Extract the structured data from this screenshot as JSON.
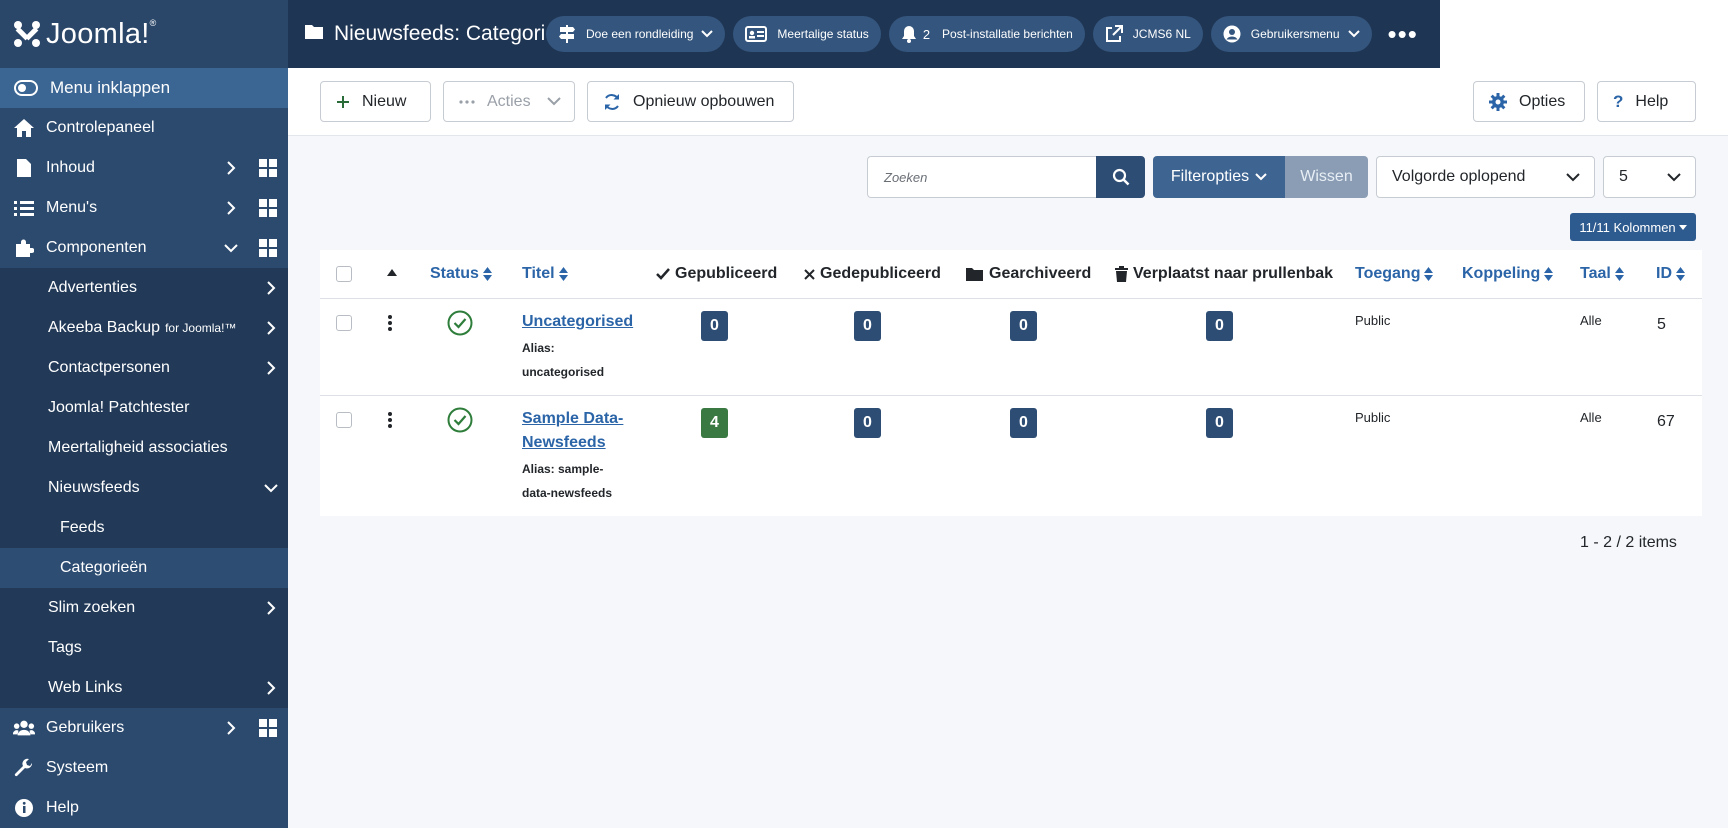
{
  "logo": {
    "text": "Joomla!",
    "mark": "®"
  },
  "sidebar": {
    "collapse_label": "Menu inklappen",
    "items": [
      {
        "label": "Controlepaneel",
        "icon": "home-icon"
      },
      {
        "label": "Inhoud",
        "icon": "file-icon"
      },
      {
        "label": "Menu's",
        "icon": "list-icon"
      },
      {
        "label": "Componenten",
        "icon": "puzzle-icon"
      },
      {
        "label": "Advertenties"
      },
      {
        "label": "Akeeba Backup",
        "suffix": "for Joomla!™"
      },
      {
        "label": "Contactpersonen"
      },
      {
        "label": "Joomla! Patchtester"
      },
      {
        "label": "Meertaligheid associaties"
      },
      {
        "label": "Nieuwsfeeds"
      },
      {
        "label": "Feeds"
      },
      {
        "label": "Categorieën"
      },
      {
        "label": "Slim zoeken"
      },
      {
        "label": "Tags"
      },
      {
        "label": "Web Links"
      },
      {
        "label": "Gebruikers",
        "icon": "users-icon"
      },
      {
        "label": "Systeem",
        "icon": "wrench-icon"
      },
      {
        "label": "Help",
        "icon": "info-icon"
      }
    ]
  },
  "header": {
    "title": "Nieuwsfeeds: Categorieën",
    "tour": "Doe een rondleiding",
    "multilang": "Meertalige status",
    "notifications_count": "2",
    "postinstall": "Post-installatie berichten",
    "site": "JCMS6 NL",
    "usermenu": "Gebruikersmenu",
    "more": "•••"
  },
  "toolbar": {
    "new": "Nieuw",
    "actions": "Acties",
    "rebuild": "Opnieuw opbouwen",
    "options": "Opties",
    "help": "Help"
  },
  "filters": {
    "search_placeholder": "Zoeken",
    "filter_options": "Filteropties",
    "clear": "Wissen",
    "order": "Volgorde oplopend",
    "limit": "5",
    "columns": "11/11 Kolommen"
  },
  "table": {
    "headers": {
      "status": "Status",
      "title": "Titel",
      "published": "Gepubliceerd",
      "unpublished": "Gedepubliceerd",
      "archived": "Gearchiveerd",
      "trashed": "Verplaatst naar prullenbak",
      "access": "Toegang",
      "association": "Koppeling",
      "language": "Taal",
      "id": "ID"
    },
    "rows": [
      {
        "title": "Uncategorised",
        "alias_label": "Alias:",
        "alias": "uncategorised",
        "published": "0",
        "unpublished": "0",
        "archived": "0",
        "trashed": "0",
        "access": "Public",
        "language": "Alle",
        "id": "5"
      },
      {
        "title_line1": "Sample Data-",
        "title_line2": "Newsfeeds",
        "alias_line1": "Alias: sample-",
        "alias_line2": "data-newsfeeds",
        "published": "4",
        "unpublished": "0",
        "archived": "0",
        "trashed": "0",
        "access": "Public",
        "language": "Alle",
        "id": "67"
      }
    ]
  },
  "pagination": "1 - 2 / 2 items",
  "colors": {
    "sidebar": "#2c4a6e",
    "header": "#1f3554",
    "accent": "#2b65a8",
    "published_badge": "#3a7a42"
  }
}
